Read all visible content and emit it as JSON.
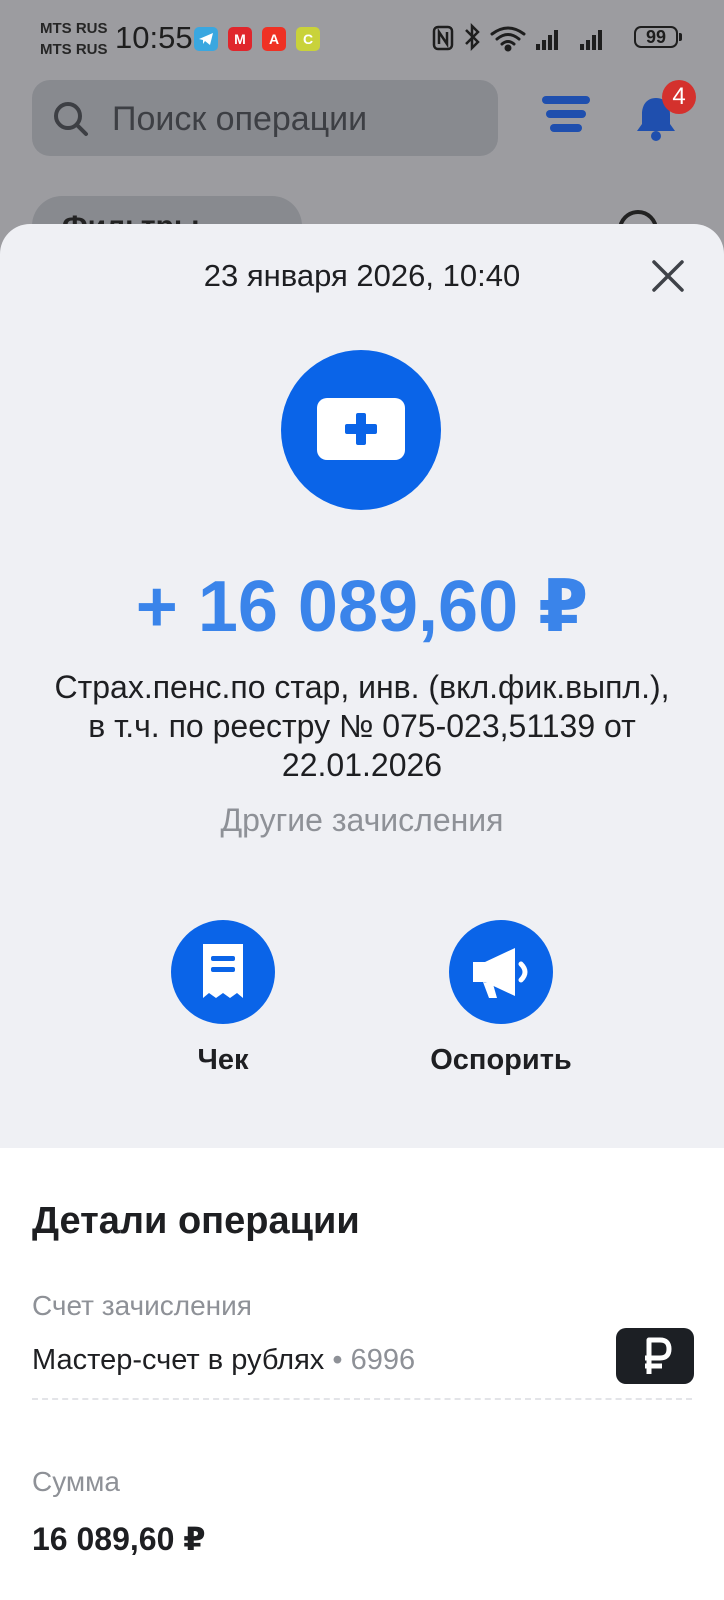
{
  "status_bar": {
    "carrier_1": "MTS RUS",
    "carrier_2": "MTS RUS",
    "time": "10:55",
    "battery": "99",
    "app_icons": [
      "telegram-icon",
      "app-red-icon",
      "alfa-bank-icon",
      "app-yellow-icon"
    ]
  },
  "header": {
    "search_placeholder": "Поиск операции",
    "notification_count": "4",
    "filters_label": "Фильтры"
  },
  "sheet": {
    "datetime": "23 января 2026, 10:40",
    "amount": "+ 16 089,60 ₽",
    "description": "Страх.пенс.по стар, инв. (вкл.фик.выпл.), в т.ч. по реестру № 075-023,51139 от 22.01.2026",
    "category": "Другие зачисления",
    "actions": [
      {
        "label": "Чек",
        "icon": "receipt-icon"
      },
      {
        "label": "Оспорить",
        "icon": "megaphone-icon"
      }
    ]
  },
  "details": {
    "title": "Детали операции",
    "account_label": "Счет зачисления",
    "account_name": "Мастер-счет в рублях",
    "account_suffix": "• 6996",
    "sum_label": "Сумма",
    "sum_value": "16 089,60 ₽"
  },
  "colors": {
    "accent": "#0a64e8",
    "amount": "#3a84ea",
    "badge": "#d4312d",
    "muted": "#8e9197"
  }
}
